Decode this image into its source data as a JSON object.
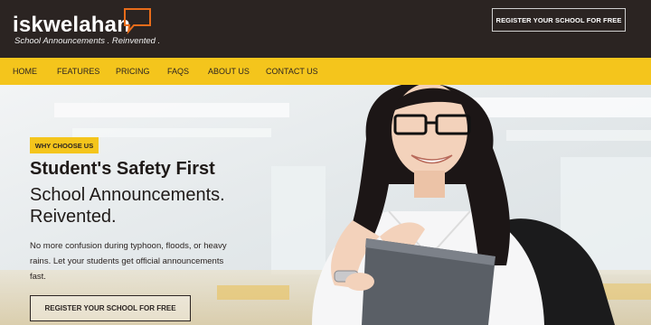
{
  "brand": {
    "name": "iskwelahan",
    "tagline": "School Announcements . Reinvented ."
  },
  "header": {
    "cta_label": "REGISTER YOUR SCHOOL FOR FREE"
  },
  "nav": {
    "items": [
      "HOME",
      "FEATURES",
      "PRICING",
      "FAQS",
      "ABOUT US",
      "CONTACT US"
    ]
  },
  "hero": {
    "badge": "WHY CHOOSE US",
    "title": "Student's Safety First",
    "subtitle_line1": "School Announcements.",
    "subtitle_line2": "Reivented.",
    "body": "No more confusion during typhoon, floods, or heavy rains. Let your students get official announcements fast.",
    "cta_label": "REGISTER YOUR SCHOOL FOR FREE"
  },
  "colors": {
    "header_bg": "#2b2422",
    "nav_bg": "#f4c51c",
    "accent": "#e86c1a"
  }
}
